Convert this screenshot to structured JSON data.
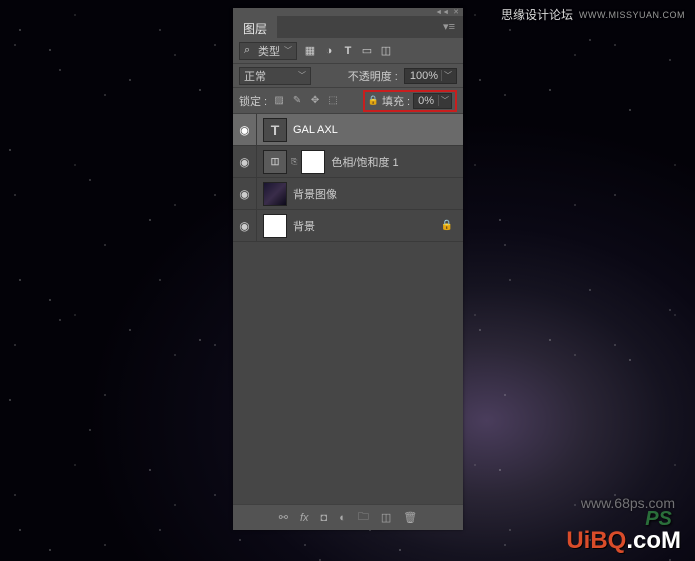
{
  "panel": {
    "tab": "图层",
    "filter": {
      "label": "类型",
      "icons": [
        "image",
        "adjust",
        "text",
        "shape",
        "smart"
      ]
    },
    "blend": {
      "mode": "正常",
      "opacity_label": "不透明度 :",
      "opacity_value": "100%"
    },
    "lock": {
      "label": "锁定 :",
      "fill_label": "填充 :",
      "fill_value": "0%"
    },
    "layers": [
      {
        "name": "GAL AXL",
        "type": "text",
        "visible": true,
        "selected": true
      },
      {
        "name": "色相/饱和度 1",
        "type": "adjustment",
        "visible": true,
        "selected": false
      },
      {
        "name": "背景图像",
        "type": "image",
        "visible": true,
        "selected": false
      },
      {
        "name": "背景",
        "type": "bg",
        "visible": true,
        "selected": false,
        "locked": true
      }
    ],
    "bottom_icons": [
      "link",
      "fx",
      "mask",
      "adj",
      "group",
      "new",
      "trash"
    ]
  },
  "watermarks": {
    "top1": "思缘设计论坛",
    "top2": "WWW.MISSYUAN.COM",
    "url68": "www.68ps.com",
    "ps": "PS",
    "uibq": "UiBQ",
    "uibq_suffix": ".coM"
  }
}
